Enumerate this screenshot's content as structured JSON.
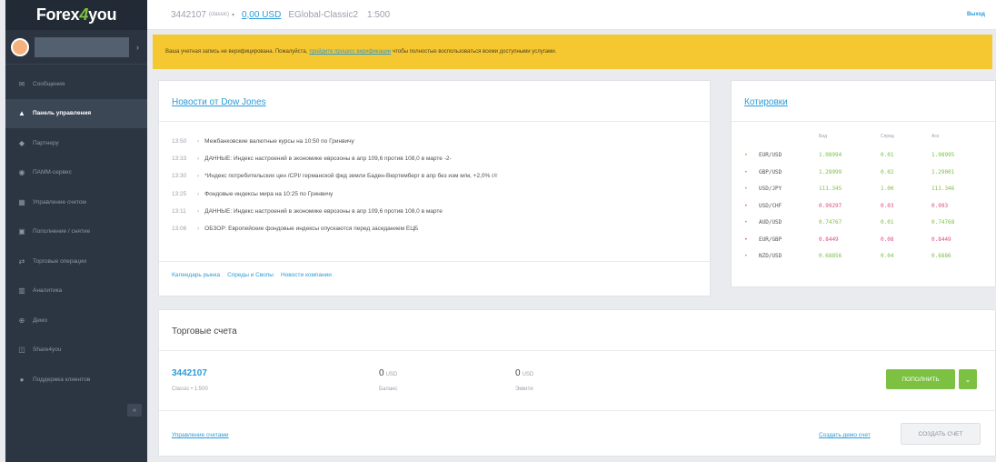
{
  "sidebar": {
    "logo_main": "Forex",
    "logo_four": "4",
    "logo_you": "you",
    "collapse_icon": "«",
    "items": [
      {
        "icon": "✉",
        "label": "Сообщения",
        "active": false
      },
      {
        "icon": "▲",
        "label": "Панель управления",
        "active": true
      },
      {
        "icon": "◆",
        "label": "Партнеру",
        "active": false
      },
      {
        "icon": "◉",
        "label": "ПАММ-сервис",
        "active": false
      },
      {
        "icon": "▦",
        "label": "Управление счетом",
        "active": false
      },
      {
        "icon": "▣",
        "label": "Пополнение / снятие",
        "active": false
      },
      {
        "icon": "⇄",
        "label": "Торговые операции",
        "active": false
      },
      {
        "icon": "▥",
        "label": "Аналитика",
        "active": false
      },
      {
        "icon": "⊕",
        "label": "Демо",
        "active": false
      },
      {
        "icon": "◫",
        "label": "Share4you",
        "active": false
      },
      {
        "icon": "●",
        "label": "Поддержка клиентов",
        "active": false
      }
    ]
  },
  "topbar": {
    "account_number": "3442107",
    "account_type": "(classic)",
    "balance": "0,00 USD",
    "server": "EGlobal-Classic2",
    "leverage": "1:500",
    "logout": "Выход"
  },
  "alert": {
    "text_before": "Ваша учетная запись не верифицирована. Пожалуйста,",
    "link": "пройдите процесс верификации",
    "text_after": "чтобы полностью воспользоваться всеми доступными услугами."
  },
  "news": {
    "title": "Новости от Dow Jones",
    "items": [
      {
        "time": "13:50",
        "text": "Межбанковские валютные курсы на 10:50 по Гринвичу"
      },
      {
        "time": "13:33",
        "text": "ДАННЫЕ: Индекс настроений в экономике еврозоны в апр 109,6 против 108,0 в марте -2-"
      },
      {
        "time": "13:30",
        "text": "*Индекс потребительских цен /CPI/ германской фед земли Баден-Вюртемберг в апр без изм м/м, +2,0% г/г"
      },
      {
        "time": "13:25",
        "text": "Фондовые индексы мира на 10:25 по Гринвичу"
      },
      {
        "time": "13:11",
        "text": "ДАННЫЕ: Индекс настроений в экономике еврозоны в апр 109,6 против 108,0 в марте"
      },
      {
        "time": "13:06",
        "text": "ОБЗОР: Европейские фондовые индексы опускаются перед заседанием ЕЦБ"
      }
    ],
    "links": [
      "Календарь рынка",
      "Спреды и Свопы",
      "Новости компании"
    ]
  },
  "quotes": {
    "title": "Котировки",
    "headers": {
      "bid": "Бид",
      "spread": "Спред",
      "ask": "Аск"
    },
    "rows": [
      {
        "symbol": "EUR/USD",
        "bid": "1.08994",
        "spread": "0.01",
        "ask": "1.08995",
        "dir": "up"
      },
      {
        "symbol": "GBP/USD",
        "bid": "1.28999",
        "spread": "0.02",
        "ask": "1.29001",
        "dir": "up"
      },
      {
        "symbol": "USD/JPY",
        "bid": "111.345",
        "spread": "1.00",
        "ask": "111.346",
        "dir": "up"
      },
      {
        "symbol": "USD/CHF",
        "bid": "0.99297",
        "spread": "0.03",
        "ask": "0.993",
        "dir": "down"
      },
      {
        "symbol": "AUD/USD",
        "bid": "0.74767",
        "spread": "0.01",
        "ask": "0.74768",
        "dir": "up"
      },
      {
        "symbol": "EUR/GBP",
        "bid": "0.8449",
        "spread": "0.08",
        "ask": "0.8449",
        "dir": "down"
      },
      {
        "symbol": "NZD/USD",
        "bid": "0.68856",
        "spread": "0.04",
        "ask": "0.6886",
        "dir": "up"
      }
    ]
  },
  "accounts": {
    "title": "Торговые счета",
    "number": "3442107",
    "subtitle": "Classic • 1:500",
    "balance_value": "0",
    "balance_currency": "USD",
    "balance_label": "Баланс",
    "equity_value": "0",
    "equity_currency": "USD",
    "equity_label": "Эквити",
    "deposit_button": "ПОПОЛНИТЬ",
    "caret": "⌄",
    "manage_link": "Управление счетами",
    "demo_link": "Создать демо счет",
    "create_button": "СОЗДАТЬ СЧЕТ"
  }
}
